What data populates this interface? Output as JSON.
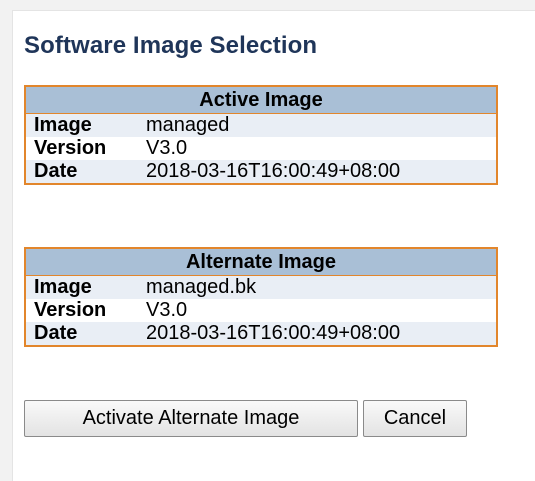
{
  "page": {
    "title": "Software Image Selection"
  },
  "active_image": {
    "header": "Active Image",
    "rows": [
      {
        "label": "Image",
        "value": "managed"
      },
      {
        "label": "Version",
        "value": "V3.0"
      },
      {
        "label": "Date",
        "value": "2018-03-16T16:00:49+08:00"
      }
    ]
  },
  "alternate_image": {
    "header": "Alternate Image",
    "rows": [
      {
        "label": "Image",
        "value": "managed.bk"
      },
      {
        "label": "Version",
        "value": "V3.0"
      },
      {
        "label": "Date",
        "value": "2018-03-16T16:00:49+08:00"
      }
    ]
  },
  "buttons": {
    "activate_label": "Activate Alternate Image",
    "cancel_label": "Cancel"
  },
  "colors": {
    "title": "#1f3559",
    "table_border": "#e2862c",
    "table_header_bg": "#a9bfd6",
    "row_alt_bg": "#e9eef5"
  }
}
